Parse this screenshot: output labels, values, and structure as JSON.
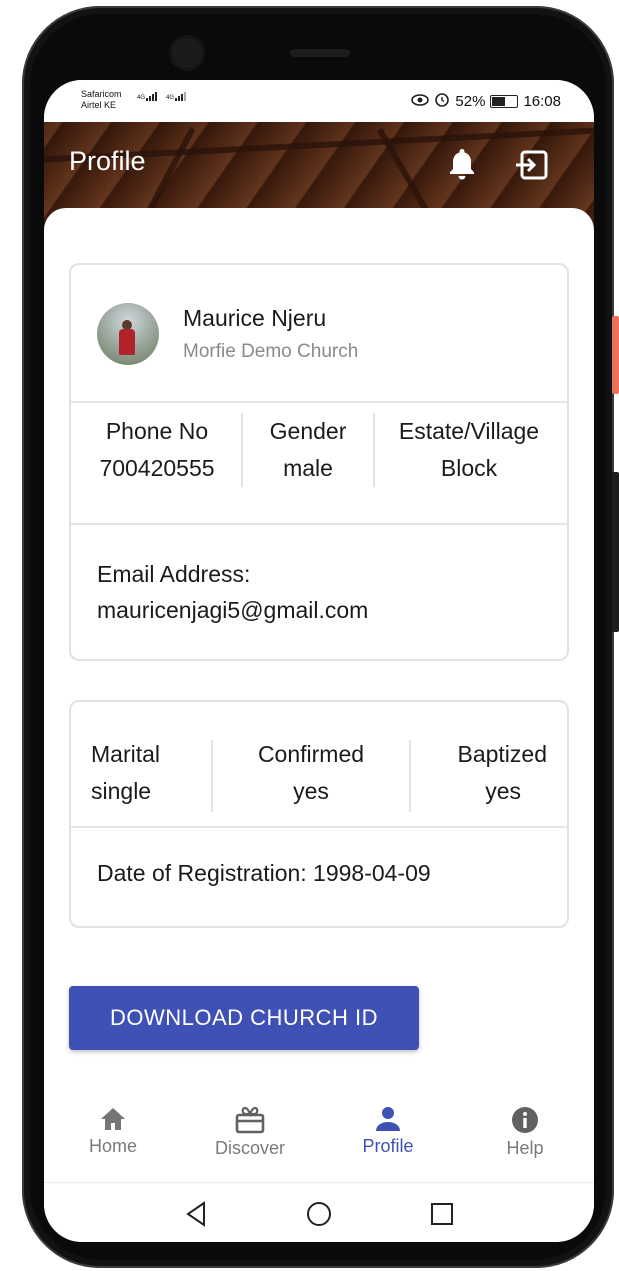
{
  "status_bar": {
    "carrier_1": "Safaricom",
    "carrier_2": "Airtel KE",
    "net_1": "4G",
    "net_2": "4G",
    "battery_percent": "52%",
    "time": "16:08"
  },
  "header": {
    "title": "Profile",
    "notification_icon": "bell-icon",
    "logout_icon": "exit-icon"
  },
  "profile": {
    "name": "Maurice Njeru",
    "church": "Morfie Demo Church",
    "phone_label": "Phone No",
    "phone_value": "700420555",
    "gender_label": "Gender",
    "gender_value": "male",
    "estate_label": "Estate/Village",
    "estate_value": "Block",
    "email_label": "Email Address:",
    "email_value": "mauricenjagi5@gmail.com"
  },
  "membership": {
    "marital_label": "Marital",
    "marital_value": "single",
    "confirmed_label": "Confirmed",
    "confirmed_value": "yes",
    "baptized_label": "Baptized",
    "baptized_value": "yes",
    "registration": "Date of Registration: 1998-04-09"
  },
  "actions": {
    "download_label": "DOWNLOAD CHURCH ID"
  },
  "bottom_nav": {
    "items": [
      {
        "label": "Home",
        "icon": "home-icon"
      },
      {
        "label": "Discover",
        "icon": "gift-icon"
      },
      {
        "label": "Profile",
        "icon": "person-icon",
        "active": true
      },
      {
        "label": "Help",
        "icon": "info-icon"
      }
    ],
    "accent_color": "#3f51b5"
  }
}
